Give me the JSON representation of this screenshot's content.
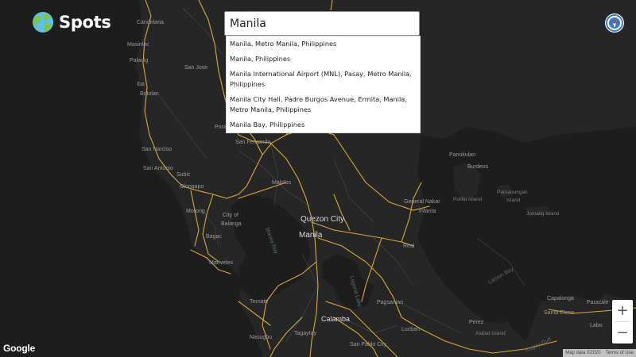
{
  "app": {
    "name": "Spots"
  },
  "search": {
    "value": "Manila",
    "placeholder": ""
  },
  "suggestions": [
    {
      "text": "Manila, Metro Manila, Philippines"
    },
    {
      "text": "Manila, Philippines"
    },
    {
      "text": "Manila International Airport (MNL), Pasay, Metro Manila, Philippines"
    },
    {
      "text": "Manila City Hall, Padre Burgos Avenue, Ermita, Manila, Metro Manila, Philippines"
    },
    {
      "text": "Manila Bay, Philippines"
    }
  ],
  "map": {
    "provider_logo": "Google",
    "attribution": {
      "data": "Map data ©2020",
      "terms": "Terms of Use"
    },
    "zoom_in_label": "+",
    "zoom_out_label": "−",
    "compass_icon": "compass-icon",
    "colors": {
      "land": "#262626",
      "water": "#1e1e1e",
      "roads": "#d8a83a",
      "minor_roads": "#4a4a4a",
      "labels": "#9a9a9a"
    },
    "labels": {
      "candelaria": "Candelaria",
      "masinloc": "Masinloc",
      "palauig": "Palauig",
      "iba": "Iba",
      "botolan": "Botolan",
      "san_jose": "San Jose",
      "san_narciso": "San Narciso",
      "san_antonio": "San Antonio",
      "subic": "Subic",
      "olongapo": "Olongapo",
      "morong": "Morong",
      "city_of_balanga": "City of\nBalanga",
      "bagac": "Bagac",
      "mariveles": "Mariveles",
      "san_fernando": "San Fernando",
      "malolos": "Malolos",
      "quezon_city": "Quezon City",
      "manila": "Manila",
      "manila_bay": "Manila Bay",
      "laguna_lake": "Laguna Lake",
      "ternate": "Ternate",
      "nasugbu": "Nasugbu",
      "tagaytay": "Tagaytay",
      "calamba": "Calamba",
      "san_pablo_city": "San Pablo City",
      "pagsanjan": "Pagsanjan",
      "lucban": "Lucban",
      "general_nakar": "General Nakar",
      "infanta": "Infanta",
      "real": "Real",
      "panukulan": "Panukulan",
      "burdeos": "Burdeos",
      "polillo_island": "Polillo Island",
      "patnanungan_island": "Patnanungan\nIsland",
      "jomalig_island": "Jomalig Island",
      "lamon_bay": "Lamon Bay",
      "capalonga": "Capalonga",
      "paracale": "Paracale",
      "labo": "Labo",
      "santa_elena": "Santa Elena",
      "perez": "Perez",
      "alabat_island": "Alabat Island",
      "ragay_gulf": "Ragay Gulf",
      "porac": "Porac"
    }
  }
}
